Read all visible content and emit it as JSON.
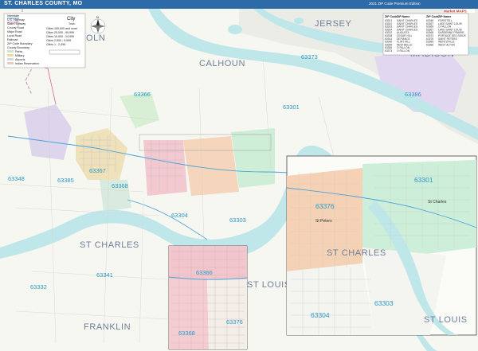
{
  "header": {
    "title": "ST. CHARLES COUNTY, MO",
    "edition": "2021 ZIP Code Premium Edition"
  },
  "brand": {
    "logo_text": "Market MAPS",
    "colors": {
      "title_bar": "#2d6aa8",
      "river": "#bfe7ea",
      "zip_label": "#2b9bc7",
      "county_label": "#6f7f9a"
    }
  },
  "compass": {
    "icon": "compass-rose-icon",
    "north_label": "N"
  },
  "legend": {
    "items": [
      "Interstate",
      "U.S. Highway",
      "State Highway",
      "County Road",
      "Major Road",
      "Local Road",
      "Railroad",
      "ZIP Code Boundary",
      "County Boundary",
      "Parks",
      "Military",
      "Airports",
      "Indian Reservation"
    ],
    "city_label": "City",
    "city_sub": "Town",
    "population_items": [
      "Cities 100,000 and more",
      "Cities 25,000 - 99,999",
      "Cities 10,000 - 24,999",
      "Cities 2,500 - 9,999",
      "Cities 1 - 2,499"
    ]
  },
  "zip_table": {
    "headers": [
      "ZIP Code",
      "ZIP Name",
      "ZIP Code",
      "ZIP Name"
    ],
    "rows": [
      [
        "63301",
        "SAINT CHARLES",
        "63348",
        "FORISTELL"
      ],
      [
        "63302",
        "SAINT CHARLES",
        "63357",
        "LAKE SAINT LOUIS"
      ],
      [
        "63303",
        "SAINT CHARLES",
        "63366",
        "O FALLON"
      ],
      [
        "63304",
        "SAINT CHARLES",
        "63367",
        "LAKE SAINT LOUIS"
      ],
      [
        "63332",
        "AUGUSTA",
        "63368",
        "DARDENNE PRAIRIE"
      ],
      [
        "63338",
        "CEDAR HILL",
        "63373",
        "PORTAGE DES SIOUX"
      ],
      [
        "63341",
        "DEFIANCE",
        "63376",
        "SAINT PETERS"
      ],
      [
        "63346",
        "FLINT HILL",
        "63385",
        "WENTZVILLE"
      ],
      [
        "63365",
        "NEW MELLE",
        "63386",
        "WEST ALTON"
      ],
      [
        "63366",
        "O FALLON",
        "",
        ""
      ],
      [
        "63373",
        "O FALLON",
        "",
        ""
      ]
    ]
  },
  "counties": {
    "jersey": "JERSEY",
    "calhoun": "CALHOUN",
    "madison": "MADISON",
    "lincoln": "OLN",
    "st_charles_main": "ST CHARLES",
    "st_charles_inset": "ST CHARLES",
    "st_louis_mid": "ST LOUIS",
    "st_louis_inset": "ST LOUIS",
    "franklin": "FRANKLIN"
  },
  "zips": {
    "z63373": "63373",
    "z63386": "63386",
    "z63366": "63366",
    "z63301": "63301",
    "z63348": "63348",
    "z63385": "63385",
    "z63367": "63367",
    "z63368": "63368",
    "z63304": "63304",
    "z63303": "63303",
    "z63332": "63332",
    "z63341": "63341",
    "inset_63376": "63376",
    "inset_63301": "63301",
    "inset_63303": "63303",
    "inset_63304": "63304",
    "inset2_63366": "63366",
    "inset2_63368": "63368",
    "inset2_63376": "63376"
  },
  "places": {
    "st_charles": "St Charles",
    "st_peters": "St Peters"
  }
}
